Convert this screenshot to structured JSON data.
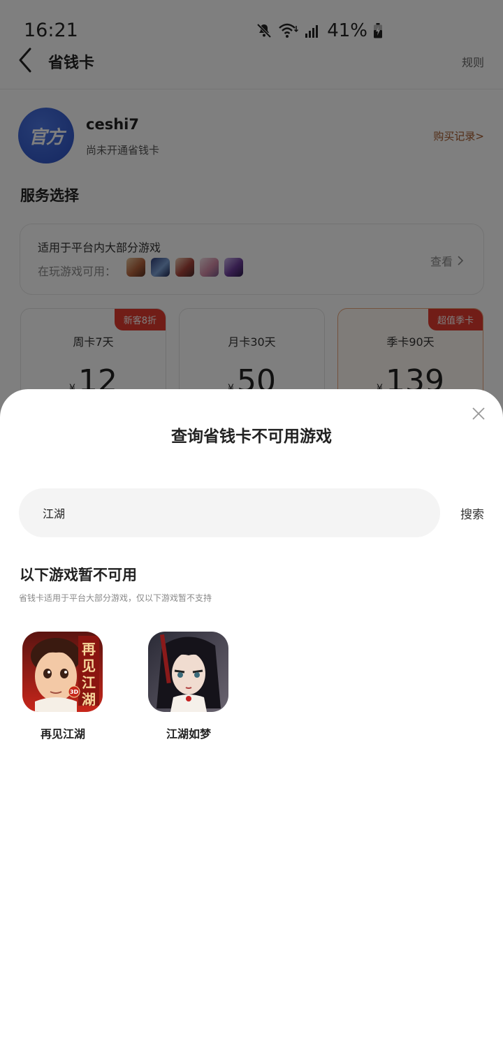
{
  "status_bar": {
    "time": "16:21",
    "battery": "41%",
    "icons": [
      "mute-icon",
      "wifi-icon",
      "signal-icon",
      "battery-icon"
    ]
  },
  "header": {
    "title": "省钱卡",
    "rule_label": "规则"
  },
  "profile": {
    "avatar_text": "官方",
    "username": "ceshi7",
    "status": "尚未开通省钱卡",
    "purchase_record_label": "购买记录>"
  },
  "service": {
    "section_title": "服务选择",
    "applicable_title": "适用于平台内大部分游戏",
    "playing_label": "在玩游戏可用：",
    "view_label": "查看"
  },
  "plans": [
    {
      "badge": "新客8折",
      "name": "周卡7天",
      "currency": "¥",
      "price": "12"
    },
    {
      "badge": "",
      "name": "月卡30天",
      "currency": "¥",
      "price": "50"
    },
    {
      "badge": "超值季卡",
      "name": "季卡90天",
      "currency": "¥",
      "price": "139"
    }
  ],
  "sheet": {
    "title": "查询省钱卡不可用游戏",
    "search": {
      "value": "江湖"
    },
    "search_button": "搜索",
    "unavailable_title": "以下游戏暂不可用",
    "unavailable_desc": "省钱卡适用于平台大部分游戏，仅以下游戏暂不支持",
    "games": [
      {
        "name": "再见江湖",
        "icon_text": "再见江湖",
        "icon_badge": "3D"
      },
      {
        "name": "江湖如梦"
      }
    ]
  },
  "colors": {
    "accent_brown": "#a4582a",
    "badge_red": "#e23a2e",
    "avatar_blue": "#2a4fc2"
  }
}
